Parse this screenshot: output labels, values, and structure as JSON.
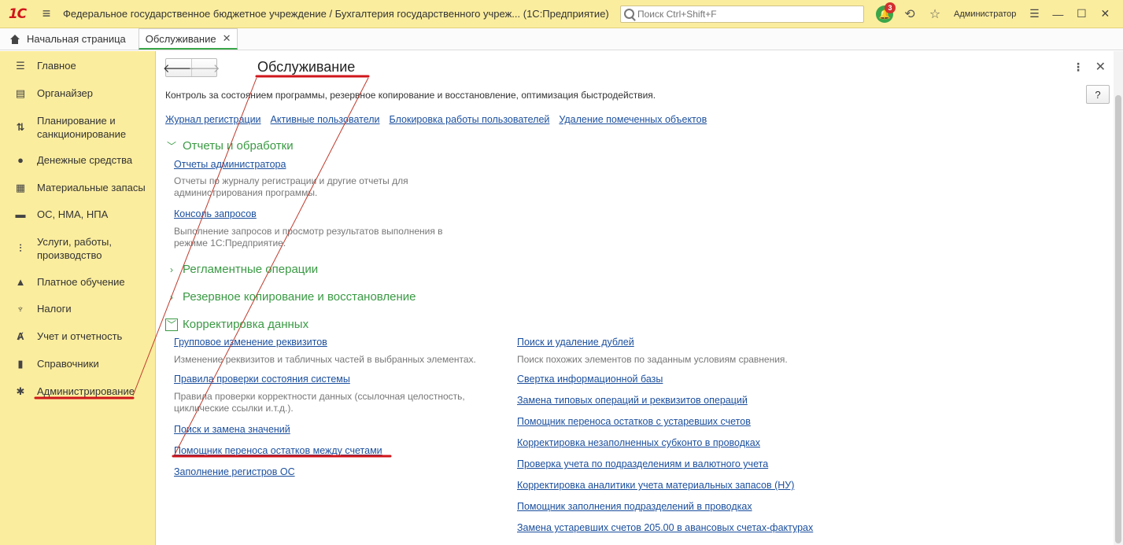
{
  "titlebar": {
    "logo": "1С",
    "title": "Федеральное государственное бюджетное учреждение / Бухгалтерия государственного учреж...   (1С:Предприятие)",
    "search_placeholder": "Поиск Ctrl+Shift+F",
    "notification_count": "3",
    "user": "Администратор"
  },
  "tabs": [
    {
      "label": "Начальная страница"
    },
    {
      "label": "Обслуживание"
    }
  ],
  "sidebar": {
    "items": [
      {
        "label": "Главное",
        "icon": "menu-lines-icon"
      },
      {
        "label": "Органайзер",
        "icon": "notepad-icon"
      },
      {
        "label": "Планирование и санкционирование",
        "icon": "planning-icon"
      },
      {
        "label": "Денежные средства",
        "icon": "coin-icon"
      },
      {
        "label": "Материальные запасы",
        "icon": "grid-icon"
      },
      {
        "label": "ОС, НМА, НПА",
        "icon": "truck-icon"
      },
      {
        "label": "Услуги, работы, производство",
        "icon": "tools-icon"
      },
      {
        "label": "Платное обучение",
        "icon": "graduation-cap-icon"
      },
      {
        "label": "Налоги",
        "icon": "eagle-icon"
      },
      {
        "label": "Учет и отчетность",
        "icon": "accounting-icon"
      },
      {
        "label": "Справочники",
        "icon": "book-icon"
      },
      {
        "label": "Администрирование",
        "icon": "gear-icon"
      }
    ]
  },
  "main": {
    "title": "Обслуживание",
    "description": "Контроль за состоянием программы, резервное копирование и восстановление, оптимизация быстродействия.",
    "help": "?",
    "top_links": [
      "Журнал регистрации",
      "Активные пользователи",
      "Блокировка работы пользователей",
      "Удаление помеченных объектов"
    ],
    "sections": {
      "reports": {
        "title": "Отчеты и обработки",
        "link1": "Отчеты администратора",
        "note1": "Отчеты по журналу регистрации и другие отчеты для администрирования программы.",
        "link2": "Консоль запросов",
        "note2": "Выполнение запросов и просмотр результатов выполнения в режиме 1С:Предприятие."
      },
      "routine": {
        "title": "Регламентные операции"
      },
      "backup": {
        "title": "Резервное копирование и восстановление"
      },
      "correction": {
        "title": "Корректировка данных",
        "left": [
          {
            "label": "Групповое изменение реквизитов",
            "note": "Изменение реквизитов и табличных частей в выбранных элементах."
          },
          {
            "label": "Правила проверки состояния системы",
            "note": "Правила проверки корректности данных (ссылочная целостность, циклические ссылки и.т.д.)."
          },
          {
            "label": "Поиск и замена значений",
            "note": ""
          },
          {
            "label": "Помощник переноса остатков между счетами",
            "note": ""
          },
          {
            "label": "Заполнение регистров ОС",
            "note": ""
          }
        ],
        "right": [
          {
            "label": "Поиск и удаление дублей",
            "note": "Поиск похожих элементов по заданным условиям сравнения."
          },
          {
            "label": "Свертка информационной базы"
          },
          {
            "label": "Замена типовых операций и реквизитов операций"
          },
          {
            "label": "Помощник переноса остатков с устаревших счетов"
          },
          {
            "label": "Корректировка незаполненных субконто в проводках"
          },
          {
            "label": "Проверка учета по подразделениям и валютного учета"
          },
          {
            "label": "Корректировка аналитики учета материальных запасов (НУ)"
          },
          {
            "label": "Помощник заполнения подразделений в проводках"
          },
          {
            "label": "Замена устаревших счетов 205.00 в авансовых счетах-фактурах"
          }
        ]
      }
    }
  },
  "colors": {
    "header_bg": "#fbed9e",
    "link": "#1b4f9e",
    "section": "#3a9a44",
    "annotation": "#d0161b"
  }
}
